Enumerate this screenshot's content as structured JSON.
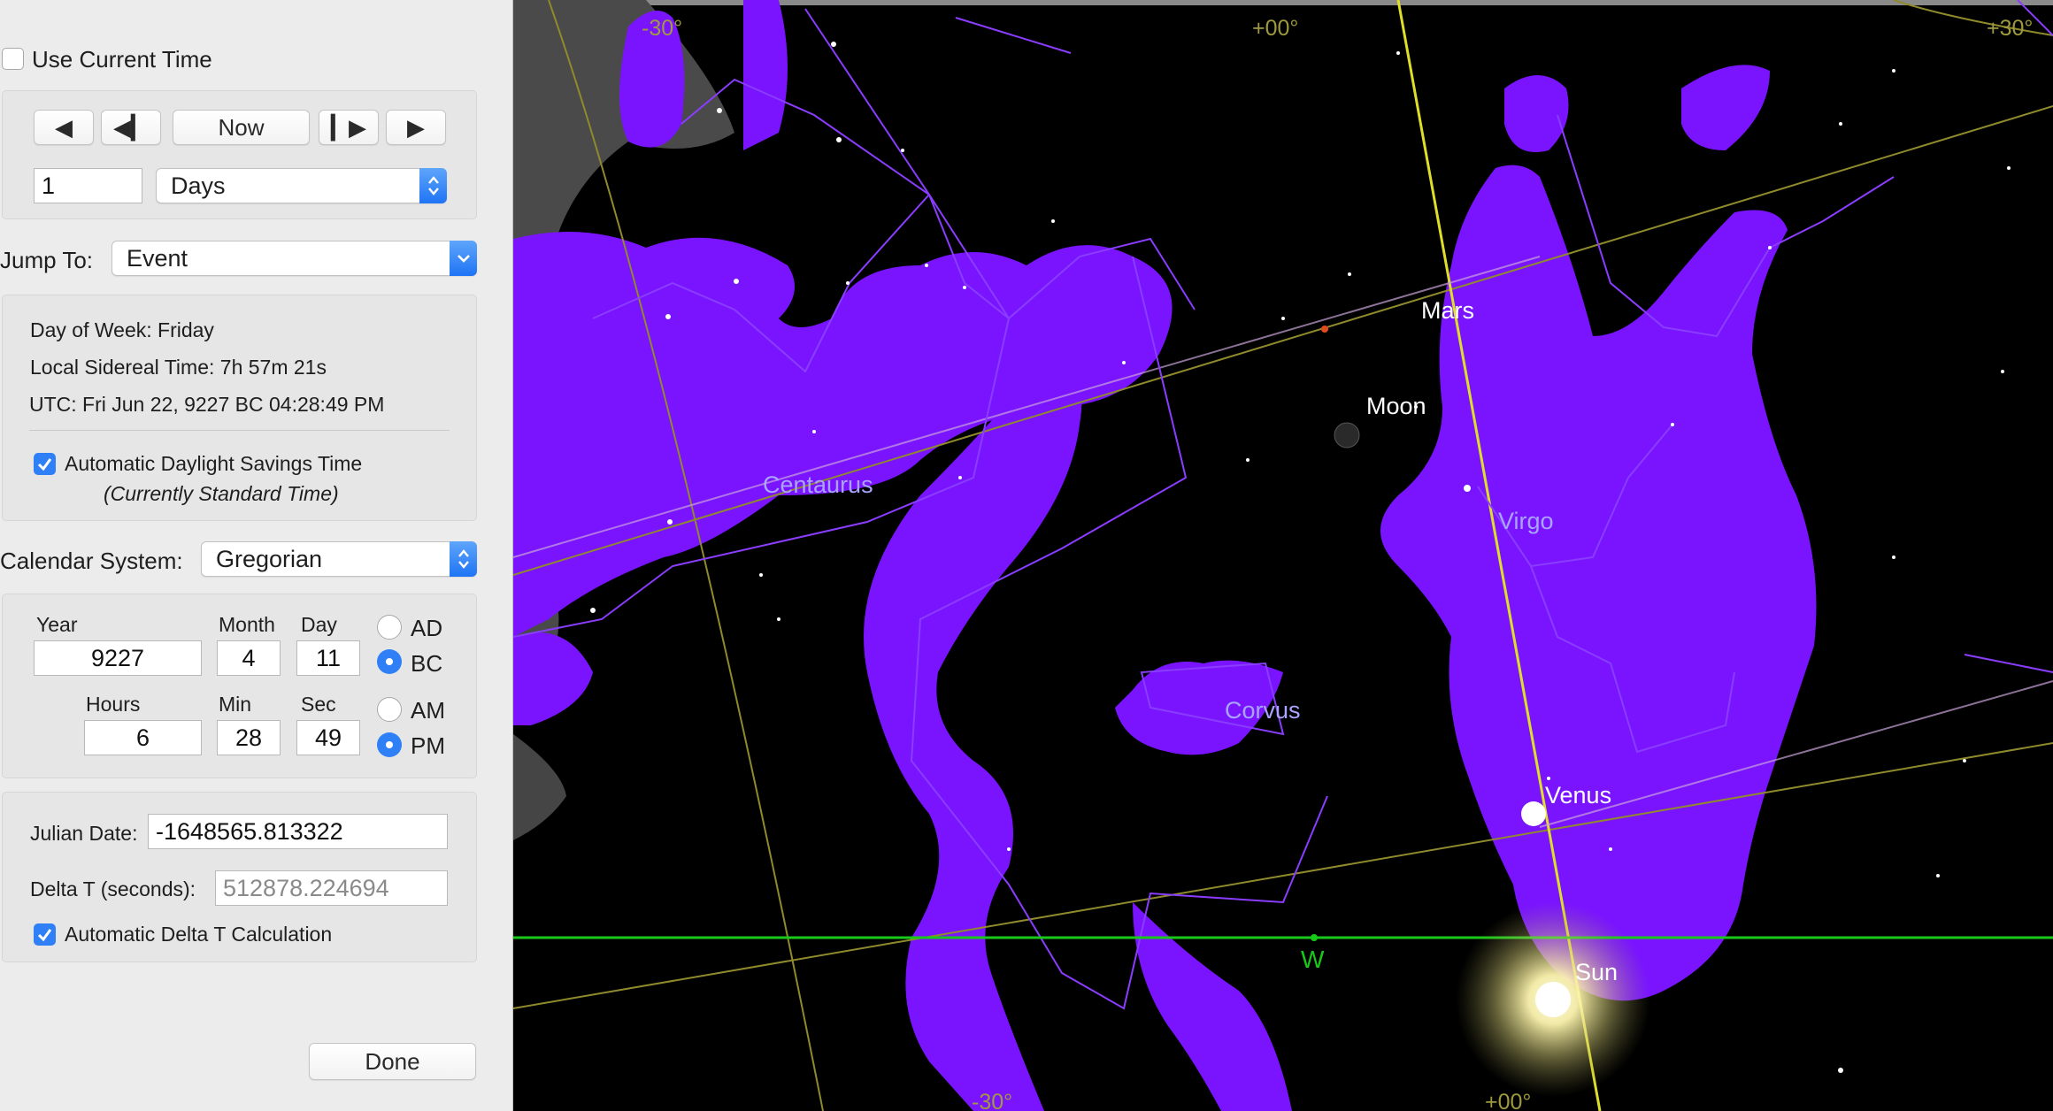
{
  "panel": {
    "use_current_time": {
      "label": "Use Current Time",
      "checked": false
    },
    "step": {
      "prev_label": "◀",
      "step_back_label": "◀▎",
      "now_label": "Now",
      "step_fwd_label": "▎▶",
      "next_label": "▶",
      "amount": "1",
      "unit": "Days"
    },
    "jump": {
      "label": "Jump To:",
      "value": "Event"
    },
    "info": {
      "day_of_week": "Day of Week:  Friday",
      "lst": "Local Sidereal Time:  7h 57m 21s",
      "utc": "UTC:  Fri Jun 22, 9227 BC 04:28:49 PM",
      "dst_label": "Automatic Daylight Savings Time",
      "dst_checked": true,
      "dst_note": "(Currently Standard Time)"
    },
    "calendar": {
      "label": "Calendar System:",
      "value": "Gregorian"
    },
    "date": {
      "year_label": "Year",
      "year": "9227",
      "month_label": "Month",
      "month": "4",
      "day_label": "Day",
      "day": "11",
      "ad_label": "AD",
      "bc_label": "BC",
      "era": "BC",
      "hours_label": "Hours",
      "hours": "6",
      "min_label": "Min",
      "min": "28",
      "sec_label": "Sec",
      "sec": "49",
      "am_label": "AM",
      "pm_label": "PM",
      "meridiem": "PM"
    },
    "julian": {
      "jd_label": "Julian Date:",
      "jd": "-1648565.813322",
      "dt_label": "Delta T (seconds):",
      "dt": "512878.224694",
      "auto_dt_label": "Automatic Delta T Calculation",
      "auto_dt_checked": true
    },
    "done_label": "Done"
  },
  "sky": {
    "grid_labels": {
      "top_left": "-30°",
      "top_mid": "+00°",
      "top_right": "+30°",
      "bottom_left": "-30°",
      "bottom_mid": "+00°"
    },
    "constellations": [
      "Centaurus",
      "Virgo",
      "Corvus"
    ],
    "planets": {
      "mars": "Mars",
      "moon": "Moon",
      "venus": "Venus",
      "sun": "Sun"
    },
    "horizon_label": "W",
    "colors": {
      "figure": "#7a14ff",
      "horizon": "#19c919",
      "grid": "#8f8a2c",
      "meridian": "#dede2a",
      "label": "#a9a4ff"
    }
  }
}
